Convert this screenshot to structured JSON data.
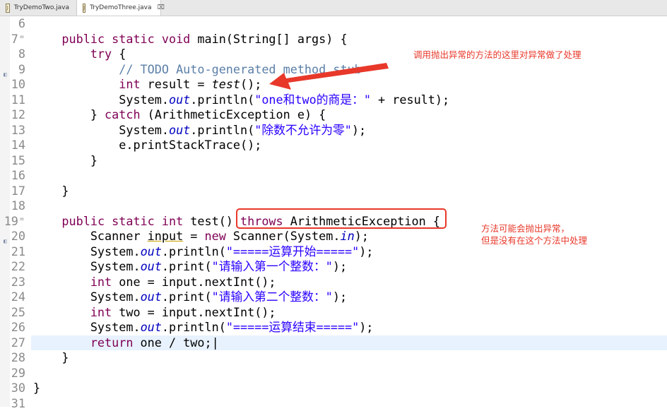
{
  "tabs": [
    {
      "label": "TryDemoTwo.java",
      "active": false
    },
    {
      "label": "TryDemoThree.java",
      "active": true,
      "close": "⌧"
    }
  ],
  "editor": {
    "current_line": 27,
    "lines": [
      {
        "n": "6",
        "t": []
      },
      {
        "n": "7",
        "fold": true,
        "t": [
          [
            "",
            "    "
          ],
          [
            "k",
            "public static void"
          ],
          [
            "",
            " main(String[] args) {"
          ]
        ]
      },
      {
        "n": "8",
        "t": [
          [
            "",
            "        "
          ],
          [
            "k",
            "try"
          ],
          [
            "",
            " {"
          ]
        ]
      },
      {
        "n": "9",
        "marker": true,
        "t": [
          [
            "",
            "            "
          ],
          [
            "c",
            "// TODO Auto-generated method stub"
          ]
        ]
      },
      {
        "n": "10",
        "t": [
          [
            "",
            "            "
          ],
          [
            "k",
            "int"
          ],
          [
            "",
            " result = "
          ],
          [
            "i",
            "test"
          ],
          [
            "",
            "();"
          ]
        ]
      },
      {
        "n": "11",
        "t": [
          [
            "",
            "            System."
          ],
          [
            "f",
            "out"
          ],
          [
            "",
            ".println("
          ],
          [
            "s",
            "\"one和two的商是：\""
          ],
          [
            "",
            " + result);"
          ]
        ]
      },
      {
        "n": "12",
        "t": [
          [
            "",
            "        } "
          ],
          [
            "k",
            "catch"
          ],
          [
            "",
            " (ArithmeticException e) {"
          ]
        ]
      },
      {
        "n": "13",
        "t": [
          [
            "",
            "            System."
          ],
          [
            "f",
            "out"
          ],
          [
            "",
            ".println("
          ],
          [
            "s",
            "\"除数不允许为零\""
          ],
          [
            "",
            ");"
          ]
        ]
      },
      {
        "n": "14",
        "t": [
          [
            "",
            "            e.printStackTrace();"
          ]
        ]
      },
      {
        "n": "15",
        "t": [
          [
            "",
            "        }"
          ]
        ]
      },
      {
        "n": "16",
        "t": []
      },
      {
        "n": "17",
        "t": [
          [
            "",
            "    }"
          ]
        ]
      },
      {
        "n": "18",
        "t": []
      },
      {
        "n": "19",
        "fold": true,
        "t": [
          [
            "",
            "    "
          ],
          [
            "k",
            "public static int"
          ],
          [
            "",
            " test() "
          ],
          [
            "k",
            "throws"
          ],
          [
            "",
            " ArithmeticException {"
          ]
        ]
      },
      {
        "n": "20",
        "marker": true,
        "t": [
          [
            "",
            "        Scanner "
          ],
          [
            "u",
            "input"
          ],
          [
            "",
            " = "
          ],
          [
            "k",
            "new"
          ],
          [
            "",
            " Scanner(System."
          ],
          [
            "f",
            "in"
          ],
          [
            "",
            ");"
          ]
        ]
      },
      {
        "n": "21",
        "t": [
          [
            "",
            "        System."
          ],
          [
            "f",
            "out"
          ],
          [
            "",
            ".println("
          ],
          [
            "s",
            "\"=====运算开始=====\""
          ],
          [
            "",
            ");"
          ]
        ]
      },
      {
        "n": "22",
        "t": [
          [
            "",
            "        System."
          ],
          [
            "f",
            "out"
          ],
          [
            "",
            ".print("
          ],
          [
            "s",
            "\"请输入第一个整数：\""
          ],
          [
            "",
            ");"
          ]
        ]
      },
      {
        "n": "23",
        "t": [
          [
            "",
            "        "
          ],
          [
            "k",
            "int"
          ],
          [
            "",
            " one = input.nextInt();"
          ]
        ]
      },
      {
        "n": "24",
        "t": [
          [
            "",
            "        System."
          ],
          [
            "f",
            "out"
          ],
          [
            "",
            ".print("
          ],
          [
            "s",
            "\"请输入第二个整数：\""
          ],
          [
            "",
            ");"
          ]
        ]
      },
      {
        "n": "25",
        "t": [
          [
            "",
            "        "
          ],
          [
            "k",
            "int"
          ],
          [
            "",
            " two = input.nextInt();"
          ]
        ]
      },
      {
        "n": "26",
        "t": [
          [
            "",
            "        System."
          ],
          [
            "f",
            "out"
          ],
          [
            "",
            ".println("
          ],
          [
            "s",
            "\"=====运算结束=====\""
          ],
          [
            "",
            ");"
          ]
        ]
      },
      {
        "n": "27",
        "t": [
          [
            "",
            "        "
          ],
          [
            "k",
            "return"
          ],
          [
            "",
            " one / two;|"
          ]
        ]
      },
      {
        "n": "28",
        "t": [
          [
            "",
            "    }"
          ]
        ]
      },
      {
        "n": "29",
        "t": []
      },
      {
        "n": "30",
        "t": [
          [
            "",
            "}"
          ]
        ]
      },
      {
        "n": "31",
        "t": []
      }
    ]
  },
  "annotations": {
    "note1": "调用抛出异常的方法的这里对异常做了处理",
    "note2_line1": "方法可能会抛出异常，",
    "note2_line2": "但是没有在这个方法中处理",
    "color": "#e8382a"
  }
}
